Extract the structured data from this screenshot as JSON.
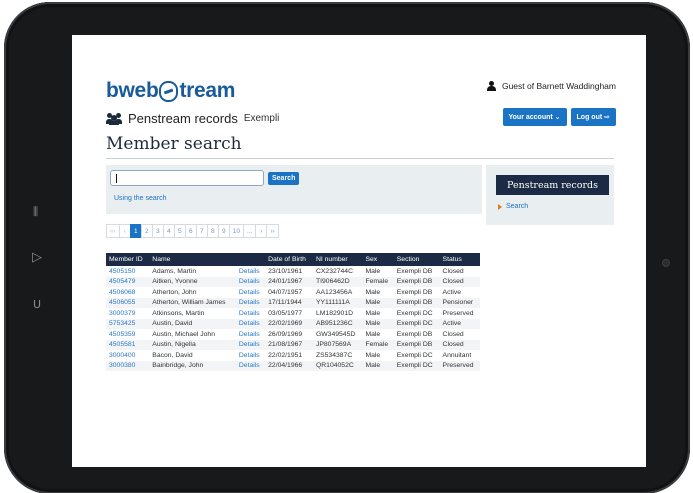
{
  "device": {
    "left_glyphs": [
      "⫼",
      "▷",
      "U"
    ]
  },
  "header": {
    "logo_part1": "bweb",
    "logo_part2": "tream",
    "guest_text": "Guest of Barnett Waddingham",
    "section_title": "Penstream records",
    "section_sub": "Exempli",
    "your_account": "Your account ⌄",
    "log_out": "Log out ⇨"
  },
  "page": {
    "title": "Member search"
  },
  "search": {
    "button": "Search",
    "help_link": "Using the search",
    "value": ""
  },
  "pager": [
    "«‹",
    "‹",
    "1",
    "2",
    "3",
    "4",
    "5",
    "6",
    "7",
    "8",
    "9",
    "10",
    "...",
    "›",
    "››"
  ],
  "pager_active": "1",
  "table": {
    "headers": [
      "Member ID",
      "Name",
      "",
      "Date of Birth",
      "NI number",
      "Sex",
      "Section",
      "Status"
    ],
    "rows": [
      [
        "4505150",
        "Adams, Martin",
        "Details",
        "23/10/1961",
        "CX232744C",
        "Male",
        "Exempli DB",
        "Closed"
      ],
      [
        "4505479",
        "Aitken, Yvonne",
        "Details",
        "24/01/1967",
        "TI906462D",
        "Female",
        "Exempli DB",
        "Closed"
      ],
      [
        "4506068",
        "Atherton, John",
        "Details",
        "04/07/1957",
        "AA123456A",
        "Male",
        "Exempli DB",
        "Active"
      ],
      [
        "4506055",
        "Atherton, William James",
        "Details",
        "17/11/1944",
        "YY111111A",
        "Male",
        "Exempli DB",
        "Pensioner"
      ],
      [
        "3000379",
        "Atkinsons, Martin",
        "Details",
        "03/05/1977",
        "LM182901D",
        "Male",
        "Exempli DC",
        "Preserved"
      ],
      [
        "5753425",
        "Austin, David",
        "Details",
        "22/02/1969",
        "AB951236C",
        "Male",
        "Exempli DC",
        "Active"
      ],
      [
        "4505359",
        "Austin, Michael John",
        "Details",
        "26/09/1969",
        "GW349545D",
        "Male",
        "Exempli DB",
        "Closed"
      ],
      [
        "4505581",
        "Austin, Nigella",
        "Details",
        "21/08/1967",
        "JP807569A",
        "Female",
        "Exempli DB",
        "Closed"
      ],
      [
        "3000400",
        "Bacon, David",
        "Details",
        "22/02/1951",
        "ZS534387C",
        "Male",
        "Exempli DC",
        "Annuitant"
      ],
      [
        "3000380",
        "Bainbridge, John",
        "Details",
        "22/04/1966",
        "QR104052C",
        "Male",
        "Exempli DC",
        "Preserved"
      ]
    ]
  },
  "sidebar": {
    "title": "Penstream records",
    "link": "Search"
  },
  "colors": {
    "brand": "#1a5b9b",
    "button": "#1a73c4",
    "navy": "#1c2a45",
    "accent": "#e07b1f"
  }
}
